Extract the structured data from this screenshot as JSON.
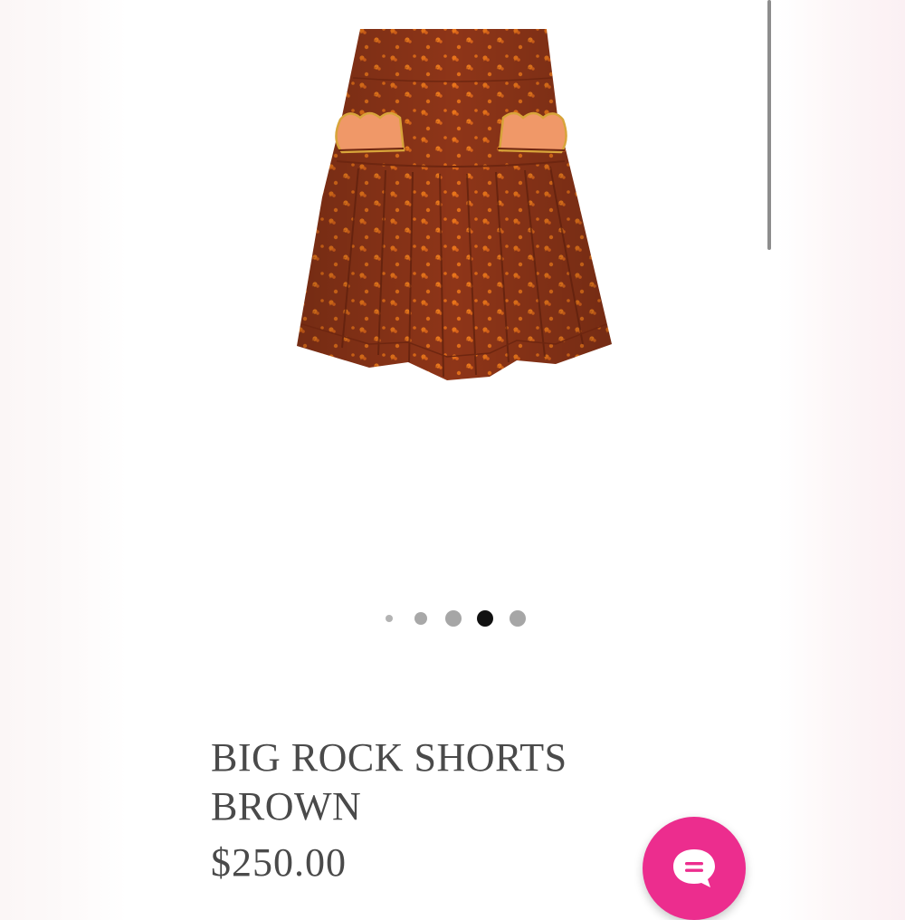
{
  "product": {
    "title": "BIG ROCK SHORTS BROWN",
    "price": "$250.00",
    "image_alt": "Brown floral print pleated high-waisted shorts with scalloped pocket flaps"
  },
  "carousel": {
    "total_slides": 5,
    "active_slide": 4
  },
  "chat": {
    "icon": "chat-bubble-icon"
  },
  "colors": {
    "chat_accent": "#ec2d8e",
    "text": "#4a4a4a",
    "fabric": "#8e3518",
    "flower": "#e07014",
    "dot_active": "#111111",
    "dot_inactive": "#a6a6a6"
  }
}
